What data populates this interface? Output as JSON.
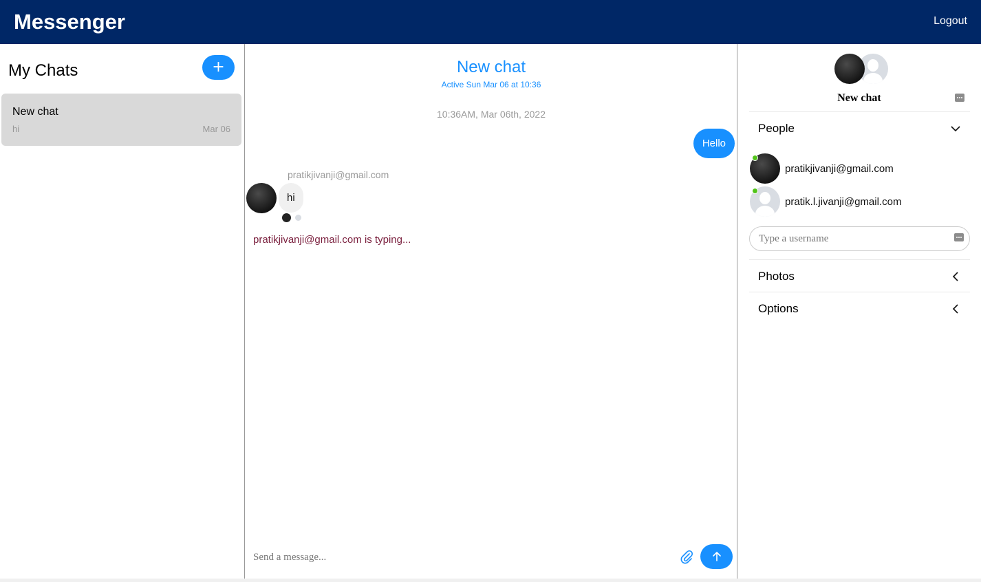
{
  "app": {
    "title": "Messenger",
    "logout_label": "Logout"
  },
  "chat_list": {
    "title": "My Chats",
    "new_button_label": "+",
    "chats": [
      {
        "title": "New chat",
        "preview": "hi",
        "date": "Mar 06"
      }
    ]
  },
  "chat_feed": {
    "title": "New chat",
    "subtitle": "Active Sun Mar 06 at 10:36",
    "timestamp": "10:36AM, Mar 06th, 2022",
    "messages": [
      {
        "direction": "outgoing",
        "text": "Hello"
      },
      {
        "direction": "incoming",
        "sender": "pratikjivanji@gmail.com",
        "text": "hi"
      }
    ],
    "typing_text": "pratikjivanji@gmail.com is typing..."
  },
  "composer": {
    "placeholder": "Send a message...",
    "attach_icon": "paperclip-icon",
    "send_icon": "arrow-up-icon"
  },
  "settings": {
    "title": "New chat",
    "people_label": "People",
    "people": [
      {
        "username": "pratikjivanji@gmail.com",
        "avatar": "dark",
        "online": true
      },
      {
        "username": "pratik.l.jivanji@gmail.com",
        "avatar": "default",
        "online": true
      }
    ],
    "username_placeholder": "Type a username",
    "photos_label": "Photos",
    "options_label": "Options"
  },
  "colors": {
    "header": "#002766",
    "accent": "#1890ff",
    "online": "#52c41a",
    "typing": "#7a1f3d",
    "selected_chat": "#d9d9d9"
  }
}
